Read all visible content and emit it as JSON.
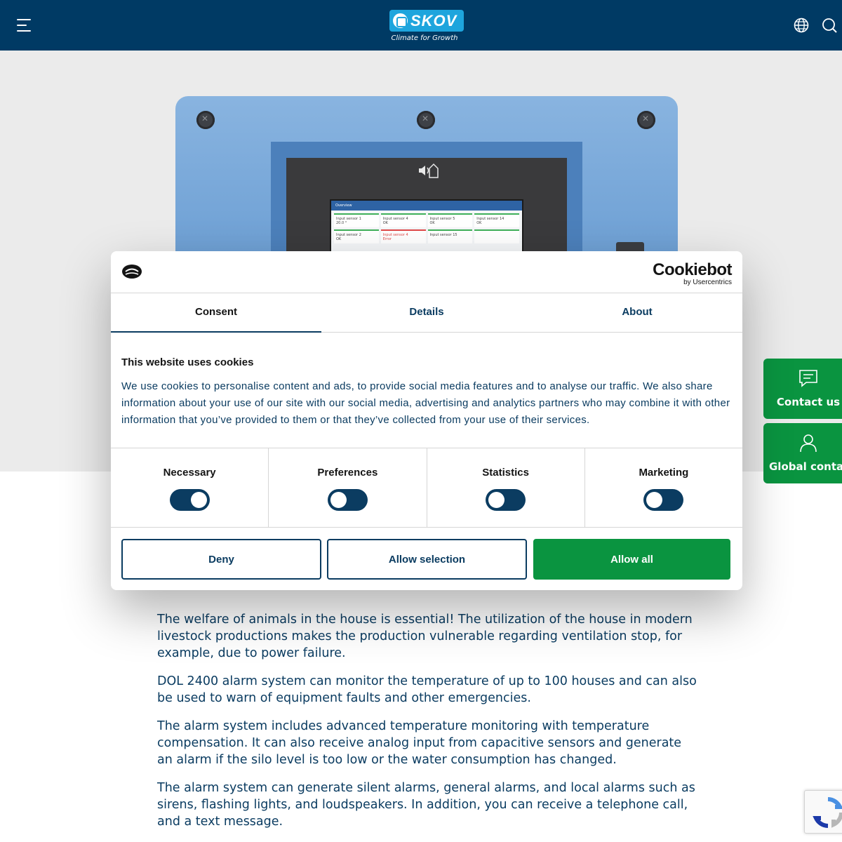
{
  "header": {
    "logo_name": "SKOV",
    "logo_tagline": "Climate for Growth",
    "menu_icon": "hamburger-menu-icon",
    "language_icon": "globe-icon",
    "search_icon": "search-icon",
    "background_color": "#003a64"
  },
  "hero": {
    "device_screen": {
      "title": "Overview",
      "tiles": [
        {
          "label": "Input sensor 1",
          "value": "20.0 °"
        },
        {
          "label": "Input sensor 4",
          "value": "OK"
        },
        {
          "label": "Input sensor 5",
          "value": "OK"
        },
        {
          "label": "Input sensor 14",
          "value": "OK"
        },
        {
          "label": "Input sensor 2",
          "value": "OK"
        },
        {
          "label": "Input sensor 4",
          "value": "Error"
        },
        {
          "label": "Input sensor 15",
          "value": ""
        },
        {
          "label": "",
          "value": ""
        }
      ]
    }
  },
  "cookie_dialog": {
    "brand": "Cookiebot",
    "brand_sub": "by Usercentrics",
    "tabs": [
      "Consent",
      "Details",
      "About"
    ],
    "active_tab": "Consent",
    "heading": "This website uses cookies",
    "body": "We use cookies to personalise content and ads, to provide social media features and to analyse our traffic. We also share information about your use of our site with our social media, advertising and analytics partners who may combine it with other information that you’ve provided to them or that they’ve collected from your use of their services.",
    "categories": [
      {
        "label": "Necessary",
        "enabled": true
      },
      {
        "label": "Preferences",
        "enabled": false
      },
      {
        "label": "Statistics",
        "enabled": false
      },
      {
        "label": "Marketing",
        "enabled": false
      }
    ],
    "buttons": {
      "deny": "Deny",
      "allow_selection": "Allow selection",
      "allow_all": "Allow all"
    },
    "accent_color": "#0a9440",
    "outline_color": "#0b3c61"
  },
  "article": {
    "paragraphs": [
      "The welfare of animals in the house is essential! The utilization of the house in modern livestock productions makes the production vulnerable regarding ventilation stop, for example, due to power failure.",
      "DOL 2400 alarm system can monitor the temperature of up to 100 houses and can also be used to warn of equipment faults and other emergencies.",
      "The alarm system includes advanced temperature monitoring with temperature compensation. It can also receive analog input from capacitive sensors and generate an alarm if the silo level is too low or the water consumption has changed.",
      "The alarm system can generate silent alarms, general alarms, and local alarms such as sirens, flashing lights, and loudspeakers. In addition, you can receive a telephone call, and a text message."
    ]
  },
  "side_buttons": {
    "contact_us": "Contact us",
    "global_contacts": "Global contac",
    "contact_icon": "chat-icon",
    "global_icon": "person-icon",
    "color": "#0a9440"
  },
  "recaptcha": {
    "icon": "recaptcha-icon"
  }
}
